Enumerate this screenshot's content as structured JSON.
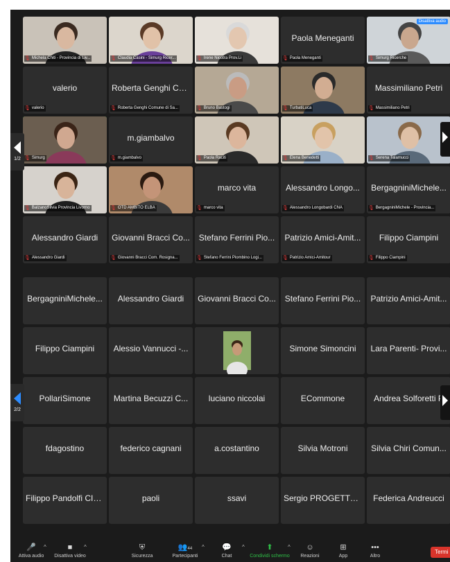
{
  "page1": {
    "rows": [
      [
        {
          "name": "",
          "label": "Michela Chiti - Provincia di Liv...",
          "video": true,
          "skin": "#d9b8a0",
          "hair": "#3a2a20",
          "bg": "#c9c2b8",
          "shirt": "#222222"
        },
        {
          "name": "",
          "label": "Claudia Casini - Simurg Ricer...",
          "video": true,
          "skin": "#e1c2a8",
          "hair": "#5a3a26",
          "bg": "#dcd6cc",
          "shirt": "#6a3f9a"
        },
        {
          "name": "",
          "label": "Irene Nicotra Prov.Li",
          "video": true,
          "skin": "#e3c7b0",
          "hair": "#d9d9d9",
          "bg": "#e6e1da",
          "shirt": "#3a3a3a"
        },
        {
          "name": "Paola Meneganti",
          "label": "Paola Meneganti",
          "video": false
        },
        {
          "name": "",
          "label": "Simurg Ricerche",
          "video": true,
          "skin": "#c9a78e",
          "hair": "#444444",
          "bg": "#cfd4d8",
          "shirt": "#5a5a5a",
          "badge": "Disattiva audio"
        }
      ],
      [
        {
          "name": "valerio",
          "label": "valerio",
          "video": false
        },
        {
          "name": "Roberta Genghi Co...",
          "label": "Roberta Genghi Comune di Sa...",
          "video": false
        },
        {
          "name": "",
          "label": "Bruno Bastogi",
          "video": true,
          "skin": "#c99c84",
          "hair": "#bbbbbb",
          "bg": "#b5a895",
          "shirt": "#4a4a4a"
        },
        {
          "name": "",
          "label": "TurbatiLuca",
          "video": true,
          "skin": "#d2ad92",
          "hair": "#2a2a2a",
          "bg": "#8d7a62",
          "shirt": "#2e3a4a"
        },
        {
          "name": "Massimiliano Petri",
          "label": "Massimiliano Petri",
          "video": false
        }
      ],
      [
        {
          "name": "",
          "label": "Simurg",
          "video": true,
          "skin": "#d0a890",
          "hair": "#3a2418",
          "bg": "#6b5e50",
          "shirt": "#8a3a5a",
          "active": true
        },
        {
          "name": "m.giambalvo",
          "label": "m.giambalvo",
          "video": false
        },
        {
          "name": "",
          "label": "Paola Raciti",
          "video": true,
          "skin": "#dcb69c",
          "hair": "#5a3a22",
          "bg": "#cfc6b8",
          "shirt": "#2a2a2a"
        },
        {
          "name": "",
          "label": "Elena Benedetti",
          "video": true,
          "skin": "#e2c4aa",
          "hair": "#c8a060",
          "bg": "#d8d2c6",
          "shirt": "#9ab0c8"
        },
        {
          "name": "",
          "label": "Serena Talamucci",
          "video": true,
          "skin": "#dfc0a6",
          "hair": "#8a6a4a",
          "bg": "#b9c2cc",
          "shirt": "#5a6a7a"
        }
      ],
      [
        {
          "name": "",
          "label": "BalzanoSilvia Provincia Livorno",
          "video": true,
          "skin": "#d8b49a",
          "hair": "#3a2414",
          "bg": "#d6d2cc",
          "shirt": "#1e1e1e"
        },
        {
          "name": "",
          "label": "OTD AMBITO ELBA",
          "video": true,
          "skin": "#c49478",
          "hair": "#2a1a10",
          "bg": "#b08a6a",
          "shirt": "#3a3a3a"
        },
        {
          "name": "marco vita",
          "label": "marco vita",
          "video": false
        },
        {
          "name": "Alessandro Longo...",
          "label": "Alessandro Longobardi CNA",
          "video": false
        },
        {
          "name": "BergagniniMichele...",
          "label": "BergagniniMichele - Provincia...",
          "video": false
        }
      ],
      [
        {
          "name": "Alessandro Giardi",
          "label": "Alessandro Giardi",
          "video": false
        },
        {
          "name": "Giovanni Bracci Co...",
          "label": "Giovanni Bracci Com. Rosigna...",
          "video": false
        },
        {
          "name": "Stefano Ferrini Pio...",
          "label": "Stefano Ferrini Piombino Logi...",
          "video": false
        },
        {
          "name": "Patrizio Amici-Amit...",
          "label": "Patrizio Amici-Amitour",
          "video": false
        },
        {
          "name": "Filippo Ciampini",
          "label": "Filippo Ciampini",
          "video": false
        }
      ]
    ],
    "nav_label": "1/2"
  },
  "page2": {
    "rows": [
      [
        {
          "name": "BergagniniMichele...",
          "video": false
        },
        {
          "name": "Alessandro Giardi",
          "video": false
        },
        {
          "name": "Giovanni Bracci Co...",
          "video": false
        },
        {
          "name": "Stefano Ferrini Pio...",
          "video": false
        },
        {
          "name": "Patrizio Amici-Amit...",
          "video": false
        }
      ],
      [
        {
          "name": "Filippo Ciampini",
          "video": false
        },
        {
          "name": "Alessio Vannucci -...",
          "video": false
        },
        {
          "name": "",
          "video": true,
          "avatar": true,
          "skin": "#c69a78",
          "hair": "#3a2616",
          "bg": "#8fae6a",
          "shirt": "#e6e6e6"
        },
        {
          "name": "Simone Simoncini",
          "video": false
        },
        {
          "name": "Lara Parenti- Provi...",
          "video": false
        }
      ],
      [
        {
          "name": "PollariSimone",
          "video": false
        },
        {
          "name": "Martina Becuzzi C...",
          "video": false
        },
        {
          "name": "luciano niccolai",
          "video": false
        },
        {
          "name": "ECommone",
          "video": false
        },
        {
          "name": "Andrea Solforetti P",
          "video": false
        }
      ],
      [
        {
          "name": "fdagostino",
          "video": false
        },
        {
          "name": "federico cagnani",
          "video": false
        },
        {
          "name": "a.costantino",
          "video": false
        },
        {
          "name": "Silvia Motroni",
          "video": false
        },
        {
          "name": "Silvia Chiri Comun...",
          "video": false
        }
      ],
      [
        {
          "name": "Filippo Pandolfi CIL...",
          "video": false
        },
        {
          "name": "paoli",
          "video": false
        },
        {
          "name": "ssavi",
          "video": false
        },
        {
          "name": "Sergio PROGETTO...",
          "video": false
        },
        {
          "name": "Federica Andreucci",
          "video": false
        }
      ]
    ],
    "nav_label": "2/2"
  },
  "toolbar": {
    "audio_label": "Attiva audio",
    "video_label": "Disattiva video",
    "security_label": "Sicurezza",
    "participants_label": "Partecipanti",
    "participants_count": "44",
    "chat_label": "Chat",
    "share_label": "Condividi schermo",
    "reactions_label": "Reazioni",
    "apps_label": "App",
    "more_label": "Altro",
    "end_label": "Termi"
  },
  "colors": {
    "accent_blue": "#2d8cff",
    "active_green": "#2fbf47",
    "mic_red": "#e03a3a",
    "end_red": "#d9342b"
  }
}
